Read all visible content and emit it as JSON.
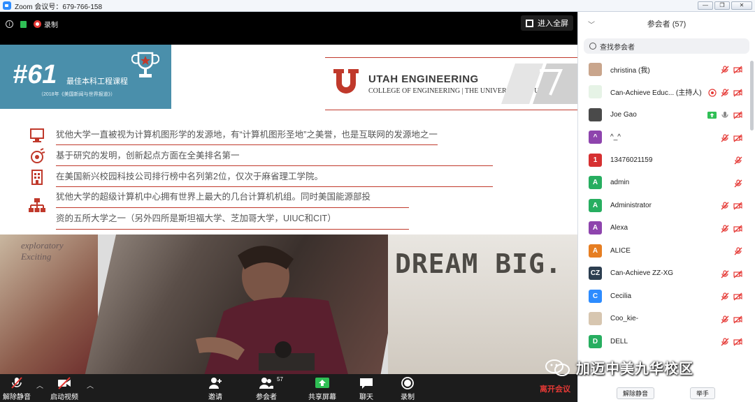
{
  "window": {
    "title": "Zoom 会议号：679-766-158",
    "buttons": [
      "—",
      "❐",
      "✕"
    ]
  },
  "meeting": {
    "recording_label": "录制",
    "fullscreen_label": "进入全屏"
  },
  "slide": {
    "rank": {
      "number": "#61",
      "title": "最佳本科工程课程",
      "subtitle": "（2018年《美国新闻与世界报道》）"
    },
    "university": {
      "name": "UTAH ENGINEERING",
      "subtitle": "COLLEGE OF ENGINEERING | THE UNIVERSITY OF UTAH"
    },
    "bullets": [
      {
        "icon": "computer-icon",
        "text": "犹他大学一直被视为计算机图形学的发源地，有“计算机图形圣地”之美誉，也是互联网的发源地之一"
      },
      {
        "icon": "research-icon",
        "text": "基于研究的发明，创新起点方面在全美排名第一"
      },
      {
        "icon": "building-icon",
        "text": "在美国新兴校园科技公司排行榜中名列第2位，仅次于麻省理工学院。"
      },
      {
        "icon": "network-icon",
        "lines": [
          "犹他大学的超级计算机中心拥有世界上最大的几台计算机机组。同时美国能源部投",
          "资的五所大学之一（另外四所是斯坦福大学、芝加哥大学，UIUC和CIT）"
        ]
      }
    ],
    "photo_text": {
      "left": "exploratory\nExciting",
      "right": "DREAM BIG. CH"
    }
  },
  "toolbar": {
    "unmute": "解除静音",
    "start_video": "启动视频",
    "invite": "邀请",
    "participants": "参会者",
    "participants_count": "57",
    "share": "共享屏幕",
    "chat": "聊天",
    "record": "录制",
    "leave": "离开会议"
  },
  "panel": {
    "title": "参会者 (57)",
    "search_placeholder": "查找参会者",
    "participants": [
      {
        "initial": "",
        "color": "#c9a58c",
        "name": "christina (我)",
        "icons": [
          "mic-off",
          "cam-off"
        ]
      },
      {
        "initial": "",
        "color": "#e6f3e6",
        "name": "Can-Achieve Educ... (主持人)",
        "icons": [
          "screen-share",
          "mic-off",
          "cam-off"
        ]
      },
      {
        "initial": "",
        "color": "#4a4a4a",
        "name": "Joe Gao",
        "icons": [
          "sharing",
          "mic",
          "cam-off"
        ]
      },
      {
        "initial": "^",
        "color": "#8e44ad",
        "name": "^_^",
        "icons": [
          "mic-off",
          "cam-off"
        ]
      },
      {
        "initial": "1",
        "color": "#d63031",
        "name": "13476021159",
        "icons": [
          "mic-off"
        ]
      },
      {
        "initial": "A",
        "color": "#27ae60",
        "name": "admin",
        "icons": [
          "mic-off"
        ]
      },
      {
        "initial": "A",
        "color": "#27ae60",
        "name": "Administrator",
        "icons": [
          "mic-off",
          "cam-off"
        ]
      },
      {
        "initial": "A",
        "color": "#8e44ad",
        "name": "Alexa",
        "icons": [
          "mic-off",
          "cam-off"
        ]
      },
      {
        "initial": "A",
        "color": "#e67e22",
        "name": "ALICE",
        "icons": [
          "mic-off"
        ]
      },
      {
        "initial": "CZ",
        "color": "#2c3e50",
        "name": "Can-Achieve ZZ-XG",
        "icons": [
          "mic-off",
          "cam-off"
        ]
      },
      {
        "initial": "C",
        "color": "#2d8cff",
        "name": "Cecilia",
        "icons": [
          "mic-off",
          "cam-off"
        ]
      },
      {
        "initial": "",
        "color": "#d7c6b0",
        "name": "Coo_kie-",
        "icons": [
          "mic-off",
          "cam-off"
        ]
      },
      {
        "initial": "D",
        "color": "#27ae60",
        "name": "DELL",
        "icons": [
          "mic-off",
          "cam-off"
        ]
      }
    ],
    "footer": {
      "unmute": "解除静音",
      "raise_hand": "举手"
    }
  },
  "watermark": "加迈中美九华校区",
  "colors": {
    "accent_red": "#c0392b",
    "zoom_blue": "#2d8cff",
    "mute_red": "#e53935",
    "share_green": "#2fbf55"
  }
}
